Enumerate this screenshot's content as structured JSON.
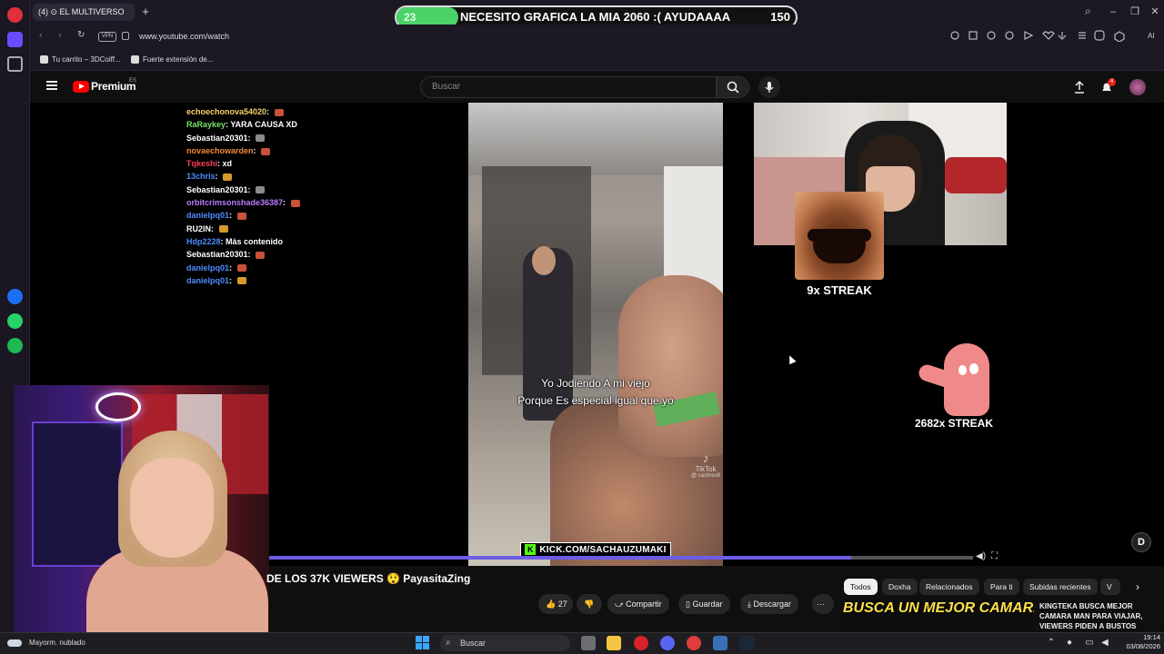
{
  "browser": {
    "tab_title": "(4) ⊙ EL MULTIVERSO",
    "new_tab": "+",
    "url": "www.youtube.com/watch",
    "vpn": "VPN",
    "bookmarks": [
      "Tu carrito – 3DCoiff...",
      "Fuerte extensión de..."
    ],
    "window_controls": [
      "–",
      "❐",
      "✕"
    ],
    "search_icon": "⌕",
    "sidebar_item": "AI"
  },
  "overlay_banner": {
    "count": "23",
    "message": "NECESITO GRAFICA LA MIA 2060 :( AYUDAAAA",
    "goal": "150",
    "accent": "#4bd36a"
  },
  "youtube": {
    "logo": "Premium",
    "region": "ES",
    "search_placeholder": "Buscar",
    "notification_count": "4",
    "title": "DE LOS 37K VIEWERS 😲 PayasitaZing",
    "actions": {
      "like_count": "27",
      "share": "Compartir",
      "save": "Guardar",
      "download": "Descargar",
      "more": "···"
    },
    "chips": [
      "Todos",
      "Doxha",
      "Relacionados",
      "Para ti",
      "Subidas recientes",
      "V"
    ],
    "recommended": {
      "thumb_text": "BUSCA UN MEJOR CAMARA MAN",
      "title": "KINGTEKA BUSCA MEJOR CAMARA MAN PARA VIAJAR, VIEWERS PIDEN A BUSTOS"
    }
  },
  "chat": [
    {
      "user": "echoechonova54020",
      "msg": "",
      "emote": true,
      "color": "#f3d36b"
    },
    {
      "user": "RaRaykey",
      "msg": "YARA CAUSA XD",
      "emote": false,
      "color": "#78e36a"
    },
    {
      "user": "Sebastian20301",
      "msg": "",
      "emote": true,
      "color": "#ffffff"
    },
    {
      "user": "novaechowarden",
      "msg": "",
      "emote": true,
      "color": "#f28a3a"
    },
    {
      "user": "Tqkeshi",
      "msg": "xd",
      "emote": false,
      "color": "#ff3d5a"
    },
    {
      "user": "13chris",
      "msg": "",
      "emote": true,
      "color": "#4d8cff"
    },
    {
      "user": "Sebastian20301",
      "msg": "",
      "emote": true,
      "color": "#ffffff"
    },
    {
      "user": "orbitcrimsonshade36387",
      "msg": "",
      "emote": true,
      "color": "#b97cff"
    },
    {
      "user": "danielpq01",
      "msg": "",
      "emote": true,
      "color": "#4d8cff"
    },
    {
      "user": "RU2IN",
      "msg": "",
      "emote": true,
      "color": "#ffffff"
    },
    {
      "user": "Hdp2228",
      "msg": "Más contenido",
      "emote": false,
      "color": "#4d8cff"
    },
    {
      "user": "Sebastian20301",
      "msg": "",
      "emote": true,
      "color": "#ffffff"
    },
    {
      "user": "danielpq01",
      "msg": "",
      "emote": true,
      "color": "#4d8cff"
    },
    {
      "user": "danielpq01",
      "msg": "",
      "emote": true,
      "color": "#4d8cff"
    }
  ],
  "video": {
    "subtitle_line1": "Yo Jodiendo A mi viejo",
    "subtitle_line2": "Porque Es especial igual que yo",
    "tiktok_label": "TikTok",
    "tiktok_handle": "@ cashrex6",
    "kick_banner": "KICK.COM/SACHAUZUMAKI",
    "streak_1": "9x STREAK",
    "streak_2": "2682x STREAK",
    "d_badge": "D",
    "progress": 0.827
  },
  "taskbar": {
    "weather": "Mayorm. nublado",
    "search": "Buscar",
    "time": "19:14",
    "date": "03/08/2026"
  }
}
